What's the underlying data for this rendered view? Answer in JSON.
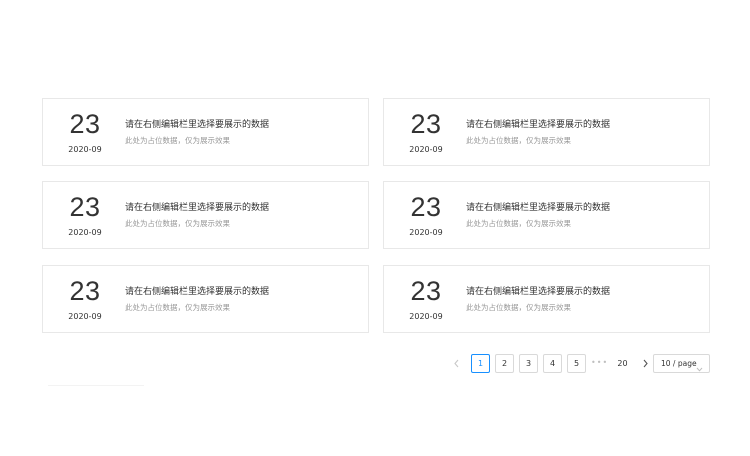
{
  "cards": [
    {
      "day": "23",
      "ym": "2020-09",
      "title": "请在右侧编辑栏里选择要展示的数据",
      "desc": "此处为占位数据，仅为展示效果"
    },
    {
      "day": "23",
      "ym": "2020-09",
      "title": "请在右侧编辑栏里选择要展示的数据",
      "desc": "此处为占位数据，仅为展示效果"
    },
    {
      "day": "23",
      "ym": "2020-09",
      "title": "请在右侧编辑栏里选择要展示的数据",
      "desc": "此处为占位数据，仅为展示效果"
    },
    {
      "day": "23",
      "ym": "2020-09",
      "title": "请在右侧编辑栏里选择要展示的数据",
      "desc": "此处为占位数据，仅为展示效果"
    },
    {
      "day": "23",
      "ym": "2020-09",
      "title": "请在右侧编辑栏里选择要展示的数据",
      "desc": "此处为占位数据，仅为展示效果"
    },
    {
      "day": "23",
      "ym": "2020-09",
      "title": "请在右侧编辑栏里选择要展示的数据",
      "desc": "此处为占位数据，仅为展示效果"
    }
  ],
  "pagination": {
    "pages": [
      "1",
      "2",
      "3",
      "4",
      "5"
    ],
    "current_page": "1",
    "ellipsis": "•••",
    "last_page": "20",
    "page_size": "10 / page",
    "prev_icon": "chevron-left-icon",
    "next_icon": "chevron-right-icon",
    "size_icon": "chevron-down-icon"
  },
  "colors": {
    "accent": "#1890ff",
    "border": "#e8e8e8",
    "text": "#333333",
    "muted": "#999999"
  }
}
